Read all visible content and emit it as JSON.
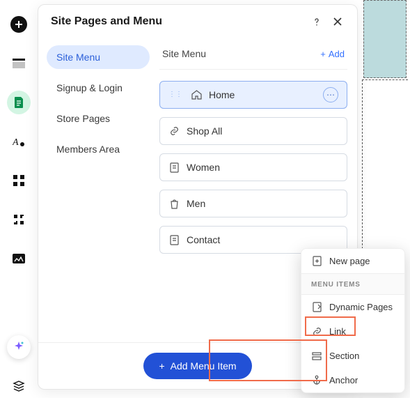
{
  "header": {
    "title": "Site Pages and Menu"
  },
  "sidebar": {
    "items": [
      {
        "label": "Site Menu"
      },
      {
        "label": "Signup & Login"
      },
      {
        "label": "Store Pages"
      },
      {
        "label": "Members Area"
      }
    ]
  },
  "main": {
    "heading": "Site Menu",
    "add_label": "Add",
    "items": [
      {
        "label": "Home",
        "icon": "home"
      },
      {
        "label": "Shop All",
        "icon": "link"
      },
      {
        "label": "Women",
        "icon": "page"
      },
      {
        "label": "Men",
        "icon": "bag"
      },
      {
        "label": "Contact",
        "icon": "page"
      }
    ]
  },
  "footer": {
    "button_label": "Add Menu Item"
  },
  "popup": {
    "top_item": "New page",
    "section_label": "MENU ITEMS",
    "options": [
      {
        "label": "Dynamic Pages",
        "icon": "dynamic"
      },
      {
        "label": "Link",
        "icon": "link"
      },
      {
        "label": "Section",
        "icon": "section"
      },
      {
        "label": "Anchor",
        "icon": "anchor"
      }
    ]
  }
}
